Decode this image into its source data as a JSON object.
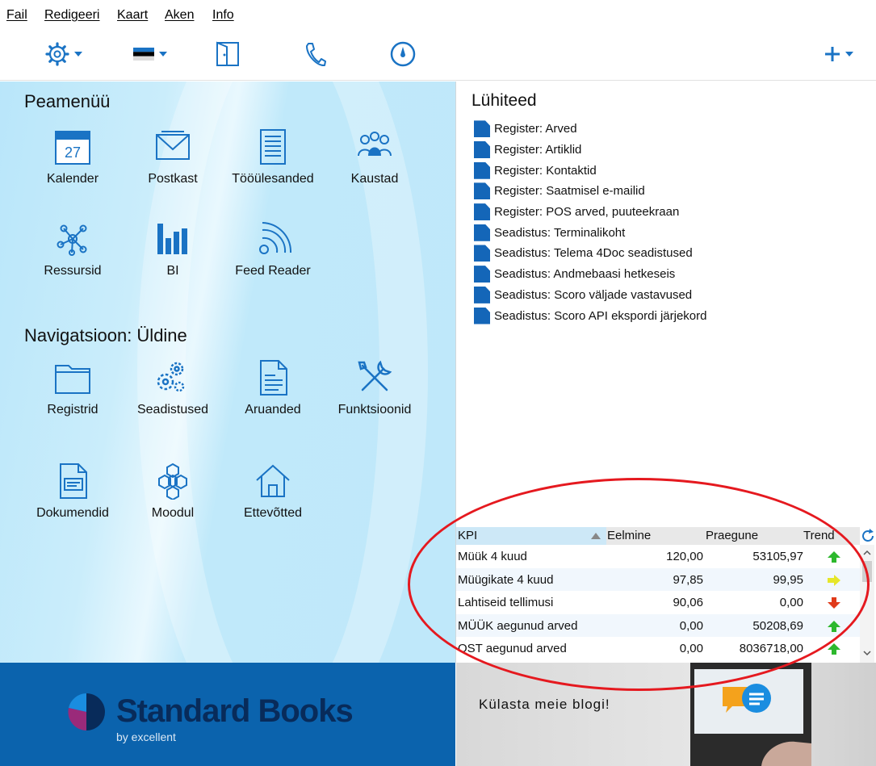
{
  "menu": [
    {
      "label": "Fail"
    },
    {
      "label": "Redigeeri"
    },
    {
      "label": "Kaart"
    },
    {
      "label": "Aken"
    },
    {
      "label": "Info"
    }
  ],
  "toolbar": {
    "icons": [
      "gear-icon",
      "flag-icon",
      "door-icon",
      "phone-icon",
      "timer-icon",
      "plus-icon"
    ],
    "accent": "#1a73c4"
  },
  "main_menu": {
    "title": "Peamenüü",
    "items": [
      {
        "label": "Kalender",
        "icon": "calendar-icon",
        "day": "27"
      },
      {
        "label": "Postkast",
        "icon": "mail-icon"
      },
      {
        "label": "Tööülesanded",
        "icon": "tasks-icon"
      },
      {
        "label": "Kaustad",
        "icon": "people-icon"
      },
      {
        "label": "Ressursid",
        "icon": "network-icon"
      },
      {
        "label": "BI",
        "icon": "bar-chart-icon"
      },
      {
        "label": "Feed Reader",
        "icon": "rss-icon"
      }
    ]
  },
  "navigation": {
    "title": "Navigatsioon: Üldine",
    "items": [
      {
        "label": "Registrid",
        "icon": "folder-icon"
      },
      {
        "label": "Seadistused",
        "icon": "gears-icon"
      },
      {
        "label": "Aruanded",
        "icon": "report-icon"
      },
      {
        "label": "Funktsioonid",
        "icon": "tools-icon"
      },
      {
        "label": "Dokumendid",
        "icon": "document-icon"
      },
      {
        "label": "Moodul",
        "icon": "hexagons-icon"
      },
      {
        "label": "Ettevõtted",
        "icon": "house-icon"
      }
    ]
  },
  "shortcuts": {
    "title": "Lühiteed",
    "items": [
      "Register: Arved",
      "Register: Artiklid",
      "Register: Kontaktid",
      "Register: Saatmisel e-mailid",
      "Register: POS arved, puuteekraan",
      "Seadistus: Terminalikoht",
      "Seadistus: Telema 4Doc seadistused",
      "Seadistus: Andmebaasi hetkeseis",
      "Seadistus: Scoro väljade vastavused",
      "Seadistus: Scoro API ekspordi järjekord"
    ]
  },
  "kpi": {
    "headers": {
      "kpi": "KPI",
      "previous": "Eelmine",
      "current": "Praegune",
      "trend": "Trend"
    },
    "rows": [
      {
        "name": "Müük 4 kuud",
        "previous": "120,00",
        "current": "53105,97",
        "trend": "up"
      },
      {
        "name": "Müügikate 4 kuud",
        "previous": "97,85",
        "current": "99,95",
        "trend": "flat"
      },
      {
        "name": "Lahtiseid tellimusi",
        "previous": "90,06",
        "current": "0,00",
        "trend": "down"
      },
      {
        "name": "MÜÜK aegunud arved",
        "previous": "0,00",
        "current": "50208,69",
        "trend": "up"
      },
      {
        "name": "OST aegunud arved",
        "previous": "0,00",
        "current": "8036718,00",
        "trend": "up"
      }
    ],
    "colors": {
      "up": "#2db82d",
      "flat": "#e6e62a",
      "down": "#e03a1a"
    }
  },
  "footer": {
    "brand": "Standard Books",
    "brand_sub": "by excellent",
    "blog_text": "Külasta meie blogi!"
  },
  "annotation_color": "#e5191f"
}
